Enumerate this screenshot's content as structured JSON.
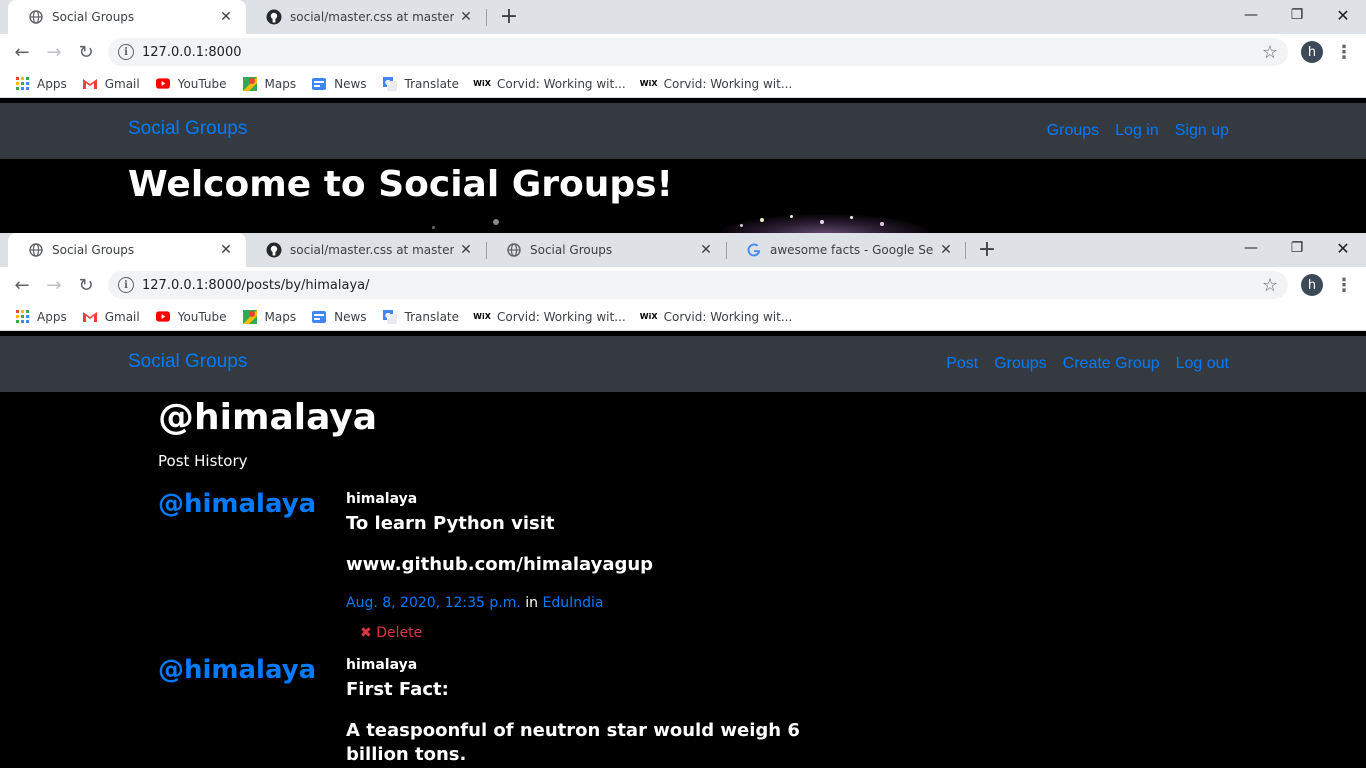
{
  "window1": {
    "tabs": [
      {
        "title": "Social Groups",
        "favicon": "globe-icon",
        "active": true
      },
      {
        "title": "social/master.css at master · Him",
        "favicon": "github-icon",
        "active": false
      }
    ],
    "url": "127.0.0.1:8000",
    "avatar_letter": "h",
    "brand": "Social Groups",
    "nav_links": [
      "Groups",
      "Log in",
      "Sign up"
    ],
    "jumbotron_title": "Welcome to Social Groups!"
  },
  "window2": {
    "tabs": [
      {
        "title": "Social Groups",
        "favicon": "globe-icon",
        "active": true
      },
      {
        "title": "social/master.css at master · Him",
        "favicon": "github-icon",
        "active": false
      },
      {
        "title": "Social Groups",
        "favicon": "globe-icon",
        "active": false
      },
      {
        "title": "awesome facts - Google Search",
        "favicon": "google-icon",
        "active": false
      }
    ],
    "url": "127.0.0.1:8000/posts/by/himalaya/",
    "avatar_letter": "h",
    "brand": "Social Groups",
    "nav_links": [
      "Post",
      "Groups",
      "Create Group",
      "Log out"
    ],
    "page": {
      "username_heading": "@himalaya",
      "subheading": "Post History",
      "posts": [
        {
          "handle": "@himalaya",
          "author": "himalaya",
          "line1": "To learn Python visit",
          "line2": "www.github.com/himalayagup",
          "date": "Aug. 8, 2020, 12:35 p.m.",
          "in_label": "in",
          "group": "EduIndia",
          "delete_label": "Delete"
        },
        {
          "handle": "@himalaya",
          "author": "himalaya",
          "line1": "First Fact:",
          "line2": "A teaspoonful of neutron star would weigh 6 billion tons."
        }
      ]
    }
  },
  "bookmarks": [
    {
      "label": "Apps",
      "icon": "apps-grid-icon"
    },
    {
      "label": "Gmail",
      "icon": "gmail-icon"
    },
    {
      "label": "YouTube",
      "icon": "youtube-icon"
    },
    {
      "label": "Maps",
      "icon": "maps-icon"
    },
    {
      "label": "News",
      "icon": "news-icon"
    },
    {
      "label": "Translate",
      "icon": "translate-icon"
    },
    {
      "label": "Corvid: Working wit...",
      "icon": "wix-icon"
    },
    {
      "label": "Corvid: Working wit...",
      "icon": "wix-icon"
    }
  ],
  "colors": {
    "link": "#007bff",
    "navbar": "#343a40",
    "danger": "#dc3545",
    "tabstrip": "#dee1e6"
  }
}
